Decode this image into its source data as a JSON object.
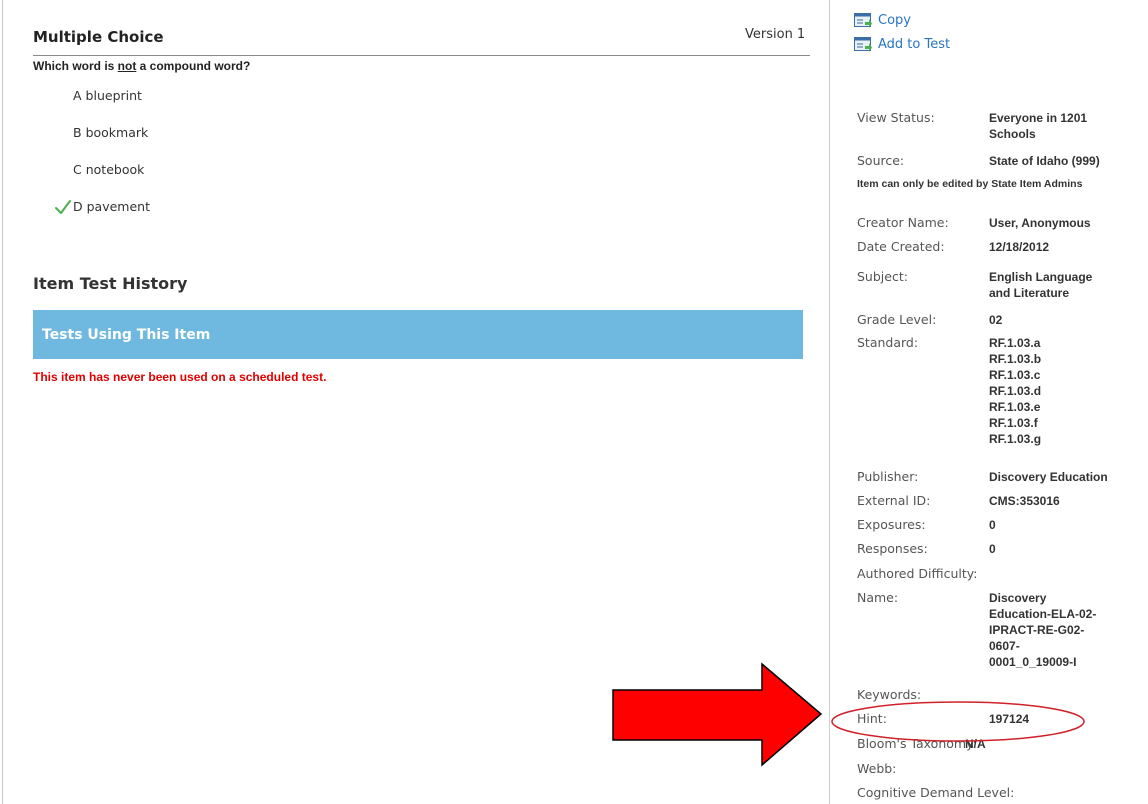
{
  "question": {
    "type_title": "Multiple Choice",
    "version": "Version 1",
    "prompt_before": "Which word is ",
    "prompt_emph": "not",
    "prompt_after": " a compound word?",
    "choices": [
      {
        "letter": "A",
        "text": "blueprint",
        "correct": false
      },
      {
        "letter": "B",
        "text": "bookmark",
        "correct": false
      },
      {
        "letter": "C",
        "text": "notebook",
        "correct": false
      },
      {
        "letter": "D",
        "text": "pavement",
        "correct": true
      }
    ],
    "correct_icon": "checkmark-icon",
    "correct_color": "#4caf50"
  },
  "history": {
    "title": "Item Test History",
    "bar_title": "Tests Using This Item",
    "bar_color": "#6fb9e1",
    "empty_message": "This item has never been used on a scheduled test.",
    "empty_color": "#e00000"
  },
  "actions": [
    {
      "label": "Copy",
      "icon": "copy-icon"
    },
    {
      "label": "Add to Test",
      "icon": "add-to-test-icon"
    }
  ],
  "details": {
    "view_status": {
      "label": "View Status:",
      "value": [
        "Everyone in 1201",
        "Schools"
      ]
    },
    "source": {
      "label": "Source:",
      "value": "State of Idaho (999)"
    },
    "edit_note": "Item can only be edited by State Item Admins",
    "creator": {
      "label": "Creator Name:",
      "value": "User, Anonymous"
    },
    "date_created": {
      "label": "Date Created:",
      "value": "12/18/2012"
    },
    "subject": {
      "label": "Subject:",
      "value": [
        "English Language",
        "and Literature"
      ]
    },
    "grade": {
      "label": "Grade Level:",
      "value": "02"
    },
    "standard": {
      "label": "Standard:",
      "value": [
        "RF.1.03.a",
        "RF.1.03.b",
        "RF.1.03.c",
        "RF.1.03.d",
        "RF.1.03.e",
        "RF.1.03.f",
        "RF.1.03.g"
      ]
    },
    "publisher": {
      "label": "Publisher:",
      "value": "Discovery Education"
    },
    "external_id": {
      "label": "External ID:",
      "value": "CMS:353016"
    },
    "exposures": {
      "label": "Exposures:",
      "value": "0"
    },
    "responses": {
      "label": "Responses:",
      "value": "0"
    },
    "authored_difficulty": {
      "label": "Authored Difficulty:"
    },
    "name": {
      "label": "Name:",
      "value": [
        "Discovery",
        "Education-ELA-02-",
        "IPRACT-RE-G02-",
        "0607-",
        "0001_0_19009-I"
      ]
    },
    "keywords": {
      "label": "Keywords:"
    },
    "hint": {
      "label": "Hint:",
      "value": "197124"
    },
    "blooms": {
      "label": "Bloom's Taxonomy:",
      "value": "N/A"
    },
    "webb": {
      "label": "Webb:"
    },
    "cognitive": {
      "label": "Cognitive Demand Level:"
    }
  },
  "annotation": {
    "arrow_color": "#ff0000",
    "circle_color": "#d0202a"
  }
}
